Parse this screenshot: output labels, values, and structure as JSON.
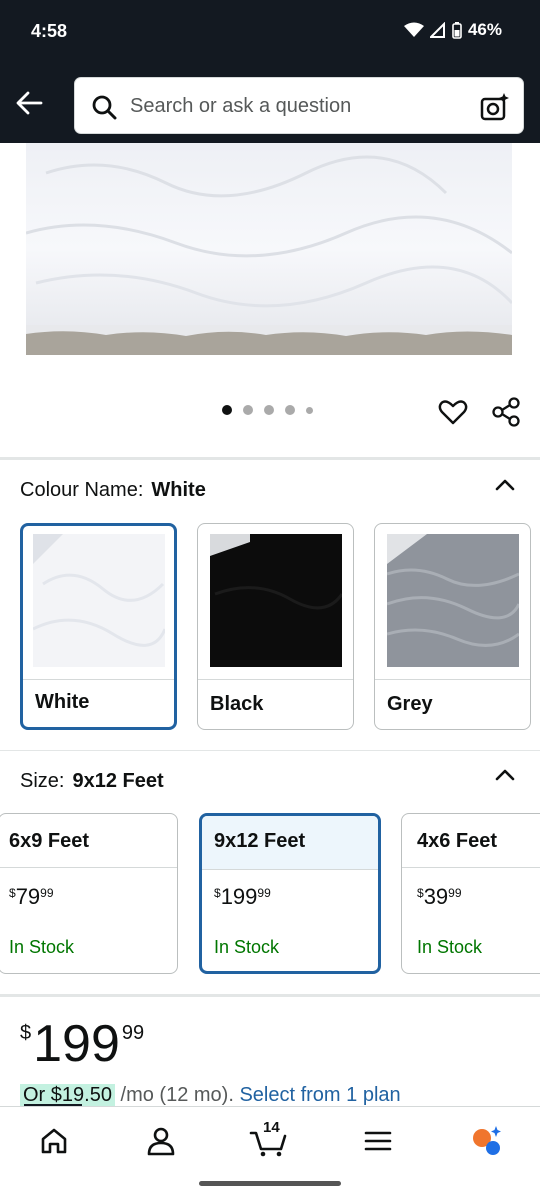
{
  "status_bar": {
    "time": "4:58",
    "battery": "46%"
  },
  "search": {
    "placeholder": "Search or ask a question"
  },
  "carousel": {
    "count": 5,
    "active_index": 0
  },
  "colour": {
    "label": "Colour Name:",
    "selected": "White",
    "options": [
      {
        "name": "White",
        "color": "#f3f4f7"
      },
      {
        "name": "Black",
        "color": "#0c0c0c"
      },
      {
        "name": "Grey",
        "color": "#8f949c"
      }
    ]
  },
  "size": {
    "label": "Size:",
    "selected": "9x12 Feet",
    "options": [
      {
        "name": "6x9 Feet",
        "currency": "$",
        "whole": "79",
        "fraction": "99",
        "stock": "In Stock"
      },
      {
        "name": "9x12 Feet",
        "currency": "$",
        "whole": "199",
        "fraction": "99",
        "stock": "In Stock"
      },
      {
        "name": "4x6 Feet",
        "currency": "$",
        "whole": "39",
        "fraction": "99",
        "stock": "In Stock"
      }
    ]
  },
  "price": {
    "currency": "$",
    "whole": "199",
    "fraction": "99"
  },
  "financing": {
    "amount": "Or $19.50",
    "term": " /mo (12 mo). ",
    "link": "Select from 1 plan"
  },
  "bottom_nav": {
    "cart_count": "14"
  },
  "colors": {
    "header": "#131921",
    "accent_blue": "#2162a1",
    "stock_green": "#007600"
  }
}
